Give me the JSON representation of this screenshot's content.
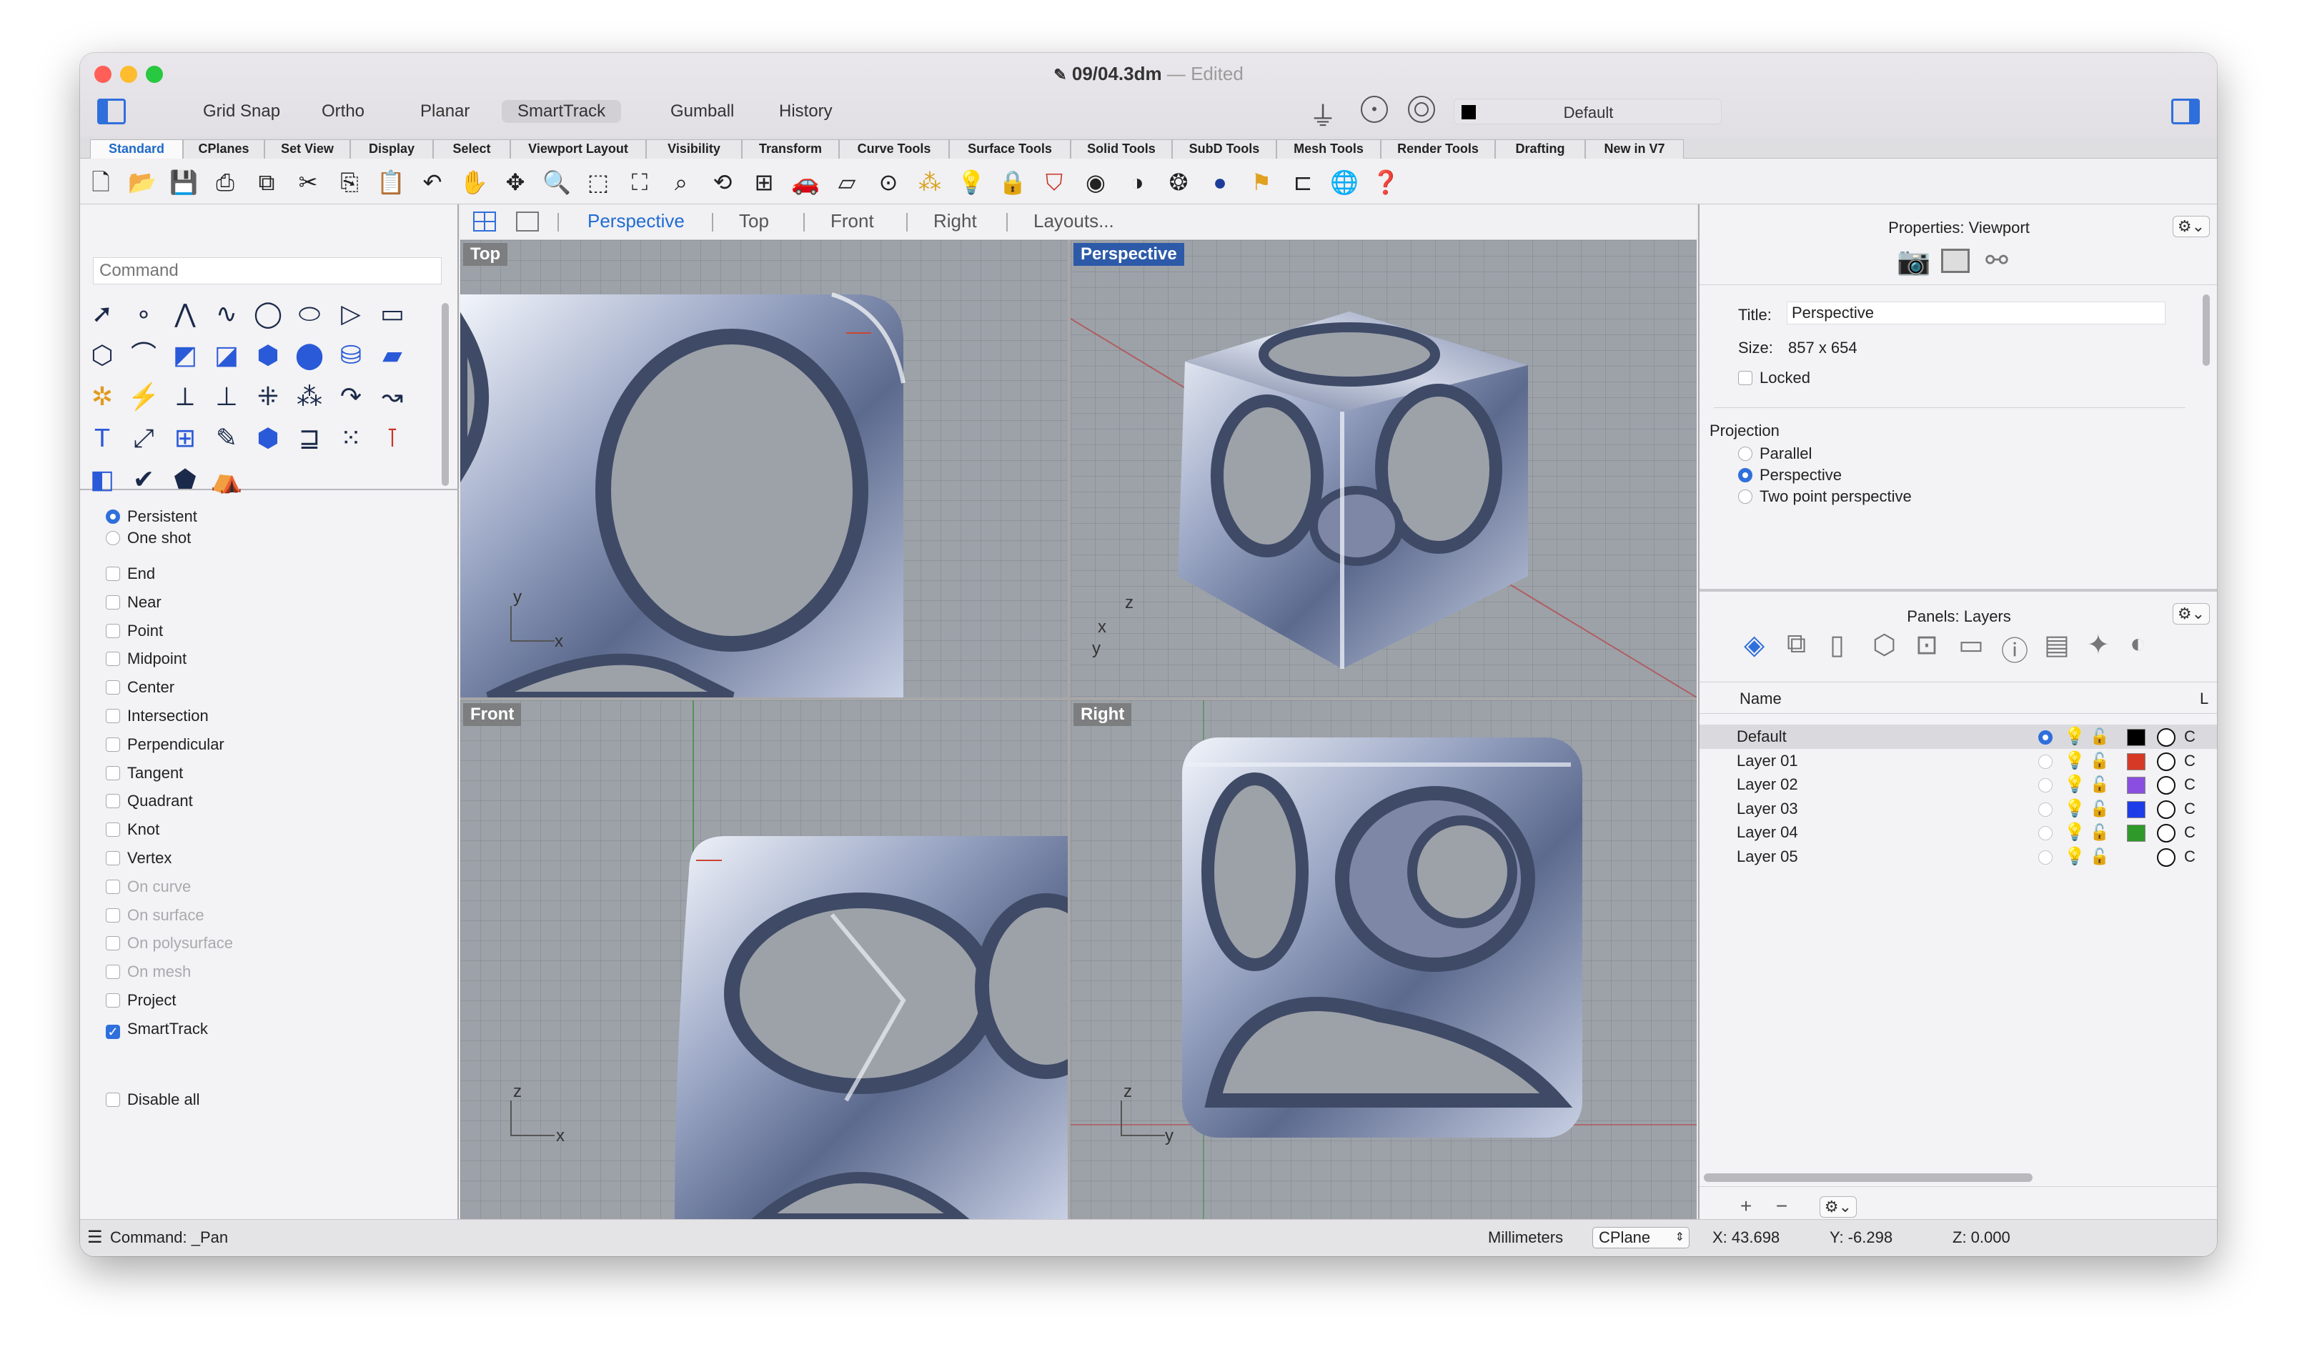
{
  "window": {
    "title": "09/04.3dm",
    "title_separator": "—",
    "title_status": "Edited"
  },
  "toolbar_top": {
    "toggles": [
      "Grid Snap",
      "Ortho",
      "Planar",
      "SmartTrack",
      "Gumball",
      "History"
    ],
    "active_toggle": "SmartTrack",
    "layer_selector": "Default"
  },
  "tabs": [
    "Standard",
    "CPlanes",
    "Set View",
    "Display",
    "Select",
    "Viewport Layout",
    "Visibility",
    "Transform",
    "Curve Tools",
    "Surface Tools",
    "Solid Tools",
    "SubD Tools",
    "Mesh Tools",
    "Render Tools",
    "Drafting",
    "New in V7"
  ],
  "active_tab": "Standard",
  "command": {
    "placeholder": "Command",
    "history": "Command: _Pan"
  },
  "osnap": {
    "modes": [
      {
        "label": "Persistent",
        "selected": true
      },
      {
        "label": "One shot",
        "selected": false
      }
    ],
    "items": [
      {
        "label": "End",
        "checked": false,
        "enabled": true
      },
      {
        "label": "Near",
        "checked": false,
        "enabled": true
      },
      {
        "label": "Point",
        "checked": false,
        "enabled": true
      },
      {
        "label": "Midpoint",
        "checked": false,
        "enabled": true
      },
      {
        "label": "Center",
        "checked": false,
        "enabled": true
      },
      {
        "label": "Intersection",
        "checked": false,
        "enabled": true
      },
      {
        "label": "Perpendicular",
        "checked": false,
        "enabled": true
      },
      {
        "label": "Tangent",
        "checked": false,
        "enabled": true
      },
      {
        "label": "Quadrant",
        "checked": false,
        "enabled": true
      },
      {
        "label": "Knot",
        "checked": false,
        "enabled": true
      },
      {
        "label": "Vertex",
        "checked": false,
        "enabled": true
      },
      {
        "label": "On curve",
        "checked": false,
        "enabled": false
      },
      {
        "label": "On surface",
        "checked": false,
        "enabled": false
      },
      {
        "label": "On polysurface",
        "checked": false,
        "enabled": false
      },
      {
        "label": "On mesh",
        "checked": false,
        "enabled": false
      },
      {
        "label": "Project",
        "checked": false,
        "enabled": true
      },
      {
        "label": "SmartTrack",
        "checked": true,
        "enabled": true
      }
    ],
    "disable_all": "Disable all"
  },
  "viewport_tabs": {
    "items": [
      "Perspective",
      "Top",
      "Front",
      "Right",
      "Layouts..."
    ],
    "active": "Perspective"
  },
  "viewports": {
    "top": {
      "label": "Top",
      "axis1": "y",
      "axis2": "x"
    },
    "perspective": {
      "label": "Perspective",
      "axis1": "z",
      "axis2": "x",
      "axis3": "y"
    },
    "front": {
      "label": "Front",
      "axis1": "z",
      "axis2": "x"
    },
    "right": {
      "label": "Right",
      "axis1": "z",
      "axis2": "y"
    }
  },
  "properties": {
    "header": "Properties: Viewport",
    "title_label": "Title:",
    "title_value": "Perspective",
    "size_label": "Size:",
    "size_value": "857 x 654",
    "locked_label": "Locked",
    "projection_label": "Projection",
    "projection_options": [
      {
        "label": "Parallel",
        "selected": false
      },
      {
        "label": "Perspective",
        "selected": true
      },
      {
        "label": "Two point perspective",
        "selected": false
      }
    ]
  },
  "layers": {
    "header": "Panels: Layers",
    "col_name": "Name",
    "col_last": "L",
    "rows": [
      {
        "name": "Default",
        "current": true,
        "color": "#000000",
        "suffix": "C"
      },
      {
        "name": "Layer 01",
        "current": false,
        "color": "#d63a26",
        "suffix": "C"
      },
      {
        "name": "Layer 02",
        "current": false,
        "color": "#8a4fe0",
        "suffix": "C"
      },
      {
        "name": "Layer 03",
        "current": false,
        "color": "#1d3de8",
        "suffix": "C"
      },
      {
        "name": "Layer 04",
        "current": false,
        "color": "#2f9a2a",
        "suffix": "C"
      },
      {
        "name": "Layer 05",
        "current": false,
        "color": "",
        "suffix": "C"
      }
    ],
    "add": "+",
    "remove": "−"
  },
  "status": {
    "units": "Millimeters",
    "cplane": "CPlane",
    "x": "X: 43.698",
    "y": "Y: -6.298",
    "z": "Z: 0.000"
  },
  "colors": {
    "accent": "#2f6fdc",
    "selected_viewport": "#2c5aa8",
    "viewport_bg": "#9da2a9"
  }
}
